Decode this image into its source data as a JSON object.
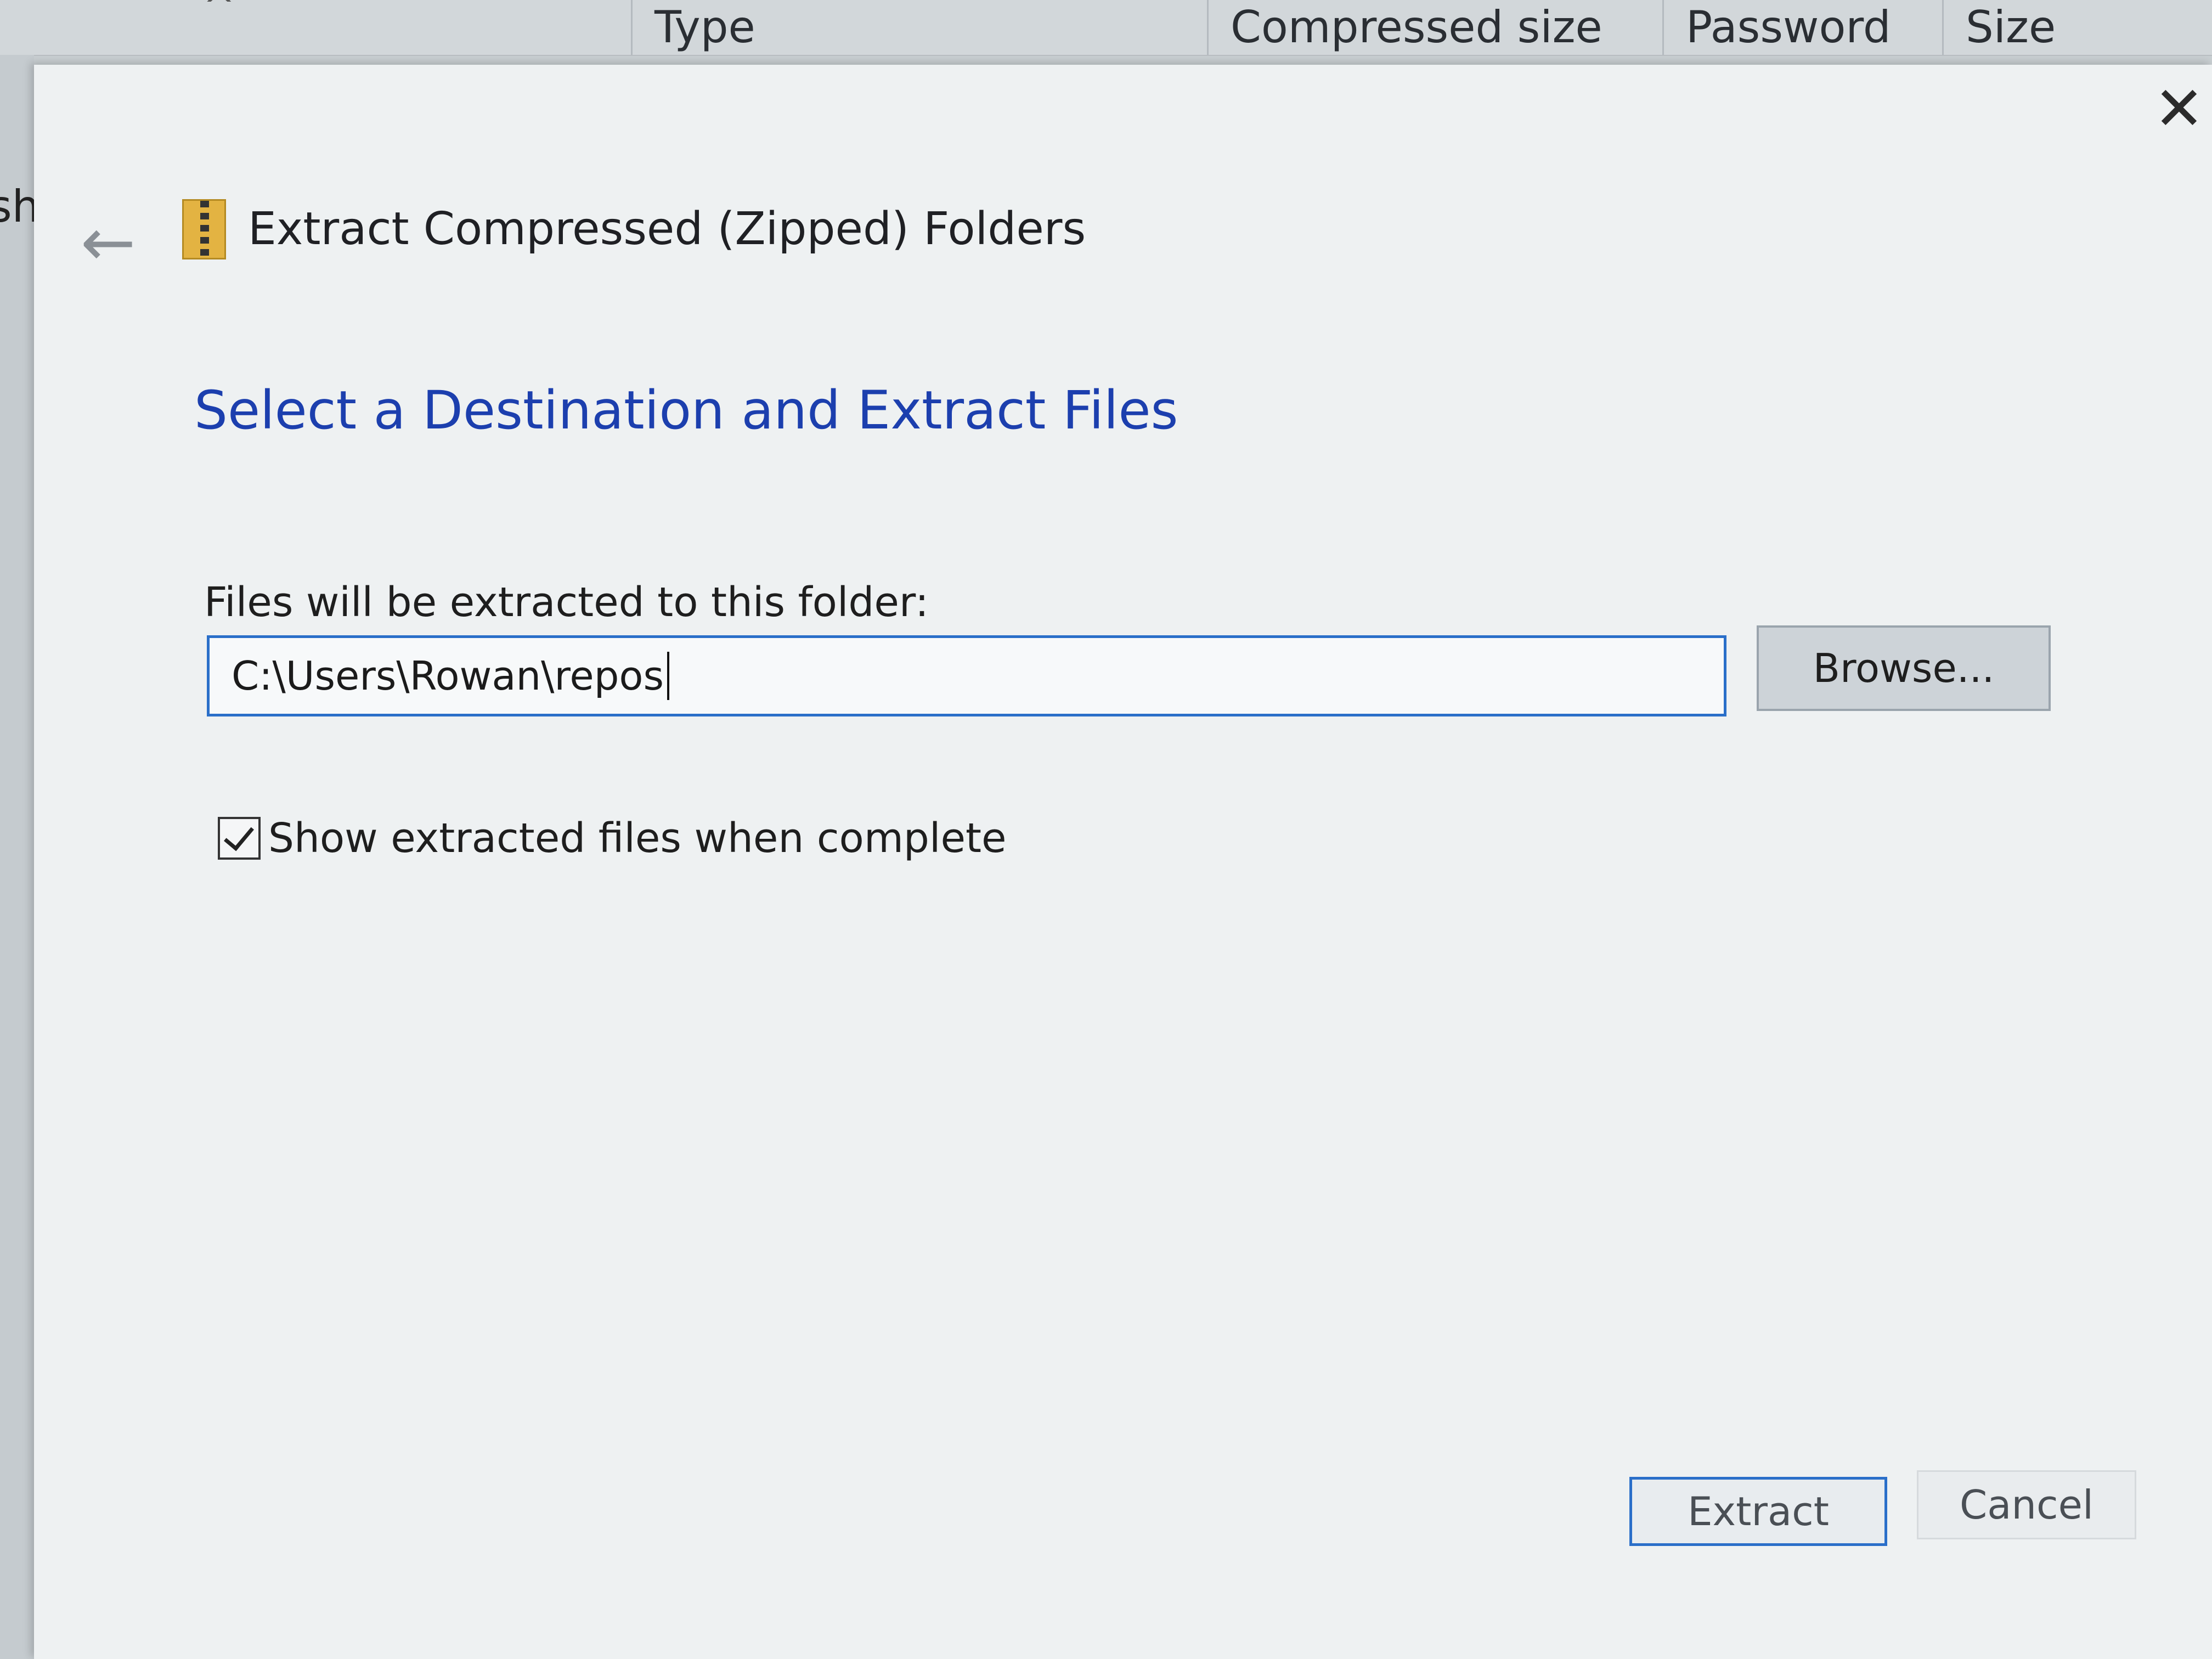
{
  "background": {
    "columns": [
      "Type",
      "Compressed size",
      "Password ...",
      "Size"
    ],
    "side_text": "shi"
  },
  "dialog": {
    "title": "Extract Compressed (Zipped) Folders",
    "heading": "Select a Destination and Extract Files",
    "folder_label": "Files will be extracted to this folder:",
    "folder_path": "C:\\Users\\Rowan\\repos",
    "browse_label": "Browse...",
    "show_files_label": "Show extracted files when complete",
    "show_files_checked": true,
    "extract_label": "Extract",
    "cancel_label": "Cancel"
  },
  "icons": {
    "close": "close-icon",
    "back": "back-arrow-icon",
    "zip": "zip-folder-icon"
  },
  "colors": {
    "heading": "#1c3fae",
    "focus_border": "#2a6fc9",
    "zip_icon": "#e3b342"
  }
}
